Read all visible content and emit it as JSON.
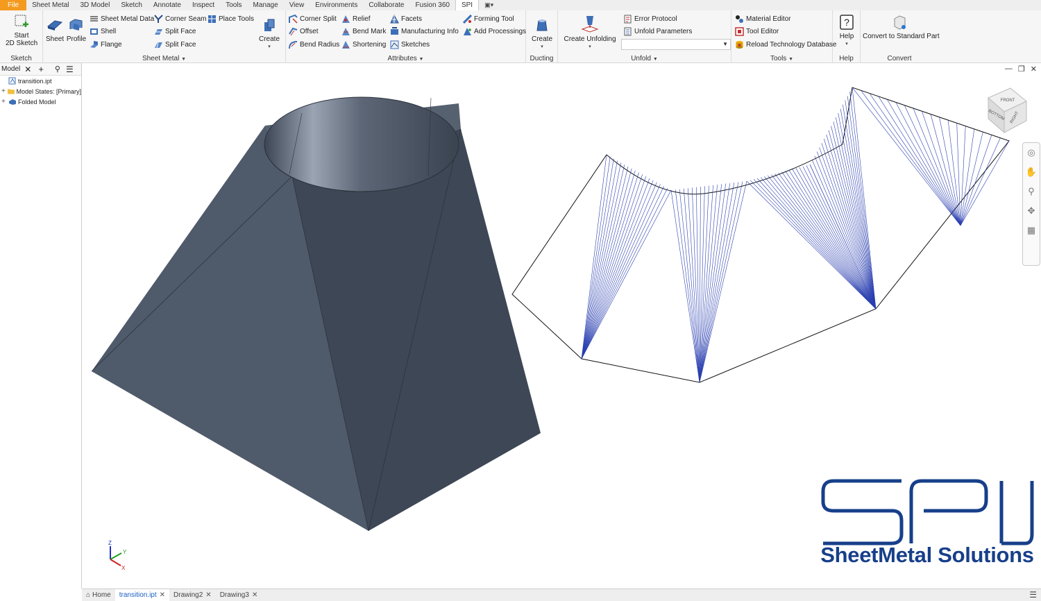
{
  "menu_tabs": [
    "File",
    "Sheet Metal",
    "3D Model",
    "Sketch",
    "Annotate",
    "Inspect",
    "Tools",
    "Manage",
    "View",
    "Environments",
    "Collaborate",
    "Fusion 360",
    "SPI"
  ],
  "ribbon": {
    "sketch": {
      "start_line1": "Start",
      "start_line2": "2D Sketch",
      "label": "Sketch"
    },
    "sheet_metal": {
      "sheet": "Sheet",
      "profile": "Profile",
      "sheet_metal_data": "Sheet Metal Data",
      "shell": "Shell",
      "flange": "Flange",
      "corner_seam": "Corner Seam",
      "split_face_1": "Split Face",
      "split_face_2": "Split Face",
      "place_tools": "Place Tools",
      "create": "Create",
      "label": "Sheet Metal"
    },
    "attributes": {
      "corner_split": "Corner Split",
      "offset": "Offset",
      "bend_radius": "Bend Radius",
      "relief": "Relief",
      "bend_mark": "Bend Mark",
      "shortening": "Shortening",
      "facets": "Facets",
      "manufacturing_info": "Manufacturing Info",
      "sketches": "Sketches",
      "forming_tool": "Forming Tool",
      "add_processings": "Add Processings",
      "label": "Attributes"
    },
    "ducting": {
      "create": "Create",
      "label": "Ducting"
    },
    "unfold": {
      "create_unfolding": "Create Unfolding",
      "error_protocol": "Error Protocol",
      "unfold_parameters": "Unfold Parameters",
      "label": "Unfold"
    },
    "tools": {
      "material_editor": "Material Editor",
      "tool_editor": "Tool Editor",
      "reload_db": "Reload Technology Database",
      "label": "Tools"
    },
    "help": {
      "help": "Help",
      "label": "Help"
    },
    "convert": {
      "convert_std": "Convert to Standard Part",
      "label": "Convert"
    }
  },
  "browser": {
    "title": "Model",
    "items": [
      {
        "label": "transition.ipt"
      },
      {
        "label": "Model States: [Primary]"
      },
      {
        "label": "Folded Model"
      }
    ]
  },
  "viewcube": {
    "front": "FRONT",
    "bottom": "BOTTOM",
    "right": "RIGHT"
  },
  "triad": {
    "z": "Z",
    "y": "Y",
    "x": "X"
  },
  "logo": {
    "text": "SheetMetal Solutions",
    "color": "#173f8a"
  },
  "doc_tabs": [
    "Home",
    "transition.ipt",
    "Drawing2",
    "Drawing3"
  ],
  "colors": {
    "file_tab": "#f49a1e",
    "model_fill": "#4a5564",
    "unfold_lines": "#2a3fb0",
    "logo_blue": "#173f8a"
  }
}
